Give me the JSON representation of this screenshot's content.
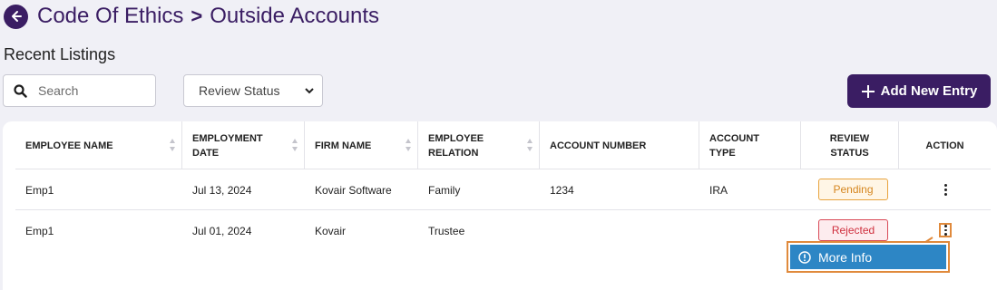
{
  "header": {
    "back_icon": "arrow-left-circle-icon",
    "breadcrumb_parent": "Code Of Ethics",
    "separator": ">",
    "breadcrumb_current": "Outside Accounts"
  },
  "section_title": "Recent Listings",
  "toolbar": {
    "search_placeholder": "Search",
    "review_status_select": "Review Status",
    "add_button_label": "Add New Entry"
  },
  "table": {
    "columns": [
      {
        "line1": "EMPLOYEE NAME",
        "line2": ""
      },
      {
        "line1": "EMPLOYMENT",
        "line2": "DATE"
      },
      {
        "line1": "FIRM NAME",
        "line2": ""
      },
      {
        "line1": "EMPLOYEE",
        "line2": "RELATION"
      },
      {
        "line1": "ACCOUNT NUMBER",
        "line2": ""
      },
      {
        "line1": "ACCOUNT",
        "line2": "TYPE"
      },
      {
        "line1": "REVIEW",
        "line2": "STATUS"
      },
      {
        "line1": "ACTION",
        "line2": ""
      }
    ],
    "rows": [
      {
        "employee_name": "Emp1",
        "employment_date": "Jul 13, 2024",
        "firm_name": "Kovair Software",
        "relation": "Family",
        "account_number": "1234",
        "account_type": "IRA",
        "status": "Pending"
      },
      {
        "employee_name": "Emp1",
        "employment_date": "Jul 01, 2024",
        "firm_name": "Kovair",
        "relation": "Trustee",
        "account_number": "",
        "account_type": "",
        "status": "Rejected"
      }
    ]
  },
  "action_menu": {
    "items": [
      {
        "label": "More Info",
        "icon": "info-circle-icon"
      }
    ]
  },
  "colors": {
    "brand": "#3a1d63",
    "pending": "#e8a33d",
    "rejected": "#d94a57",
    "menu_highlight": "#2d86c5",
    "annotation": "#e08a3c"
  }
}
